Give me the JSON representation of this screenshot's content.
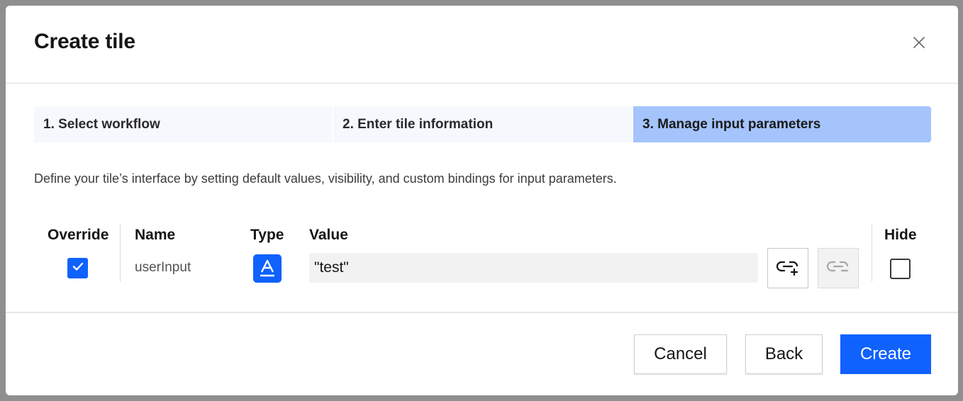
{
  "modal": {
    "title": "Create tile"
  },
  "steps": [
    {
      "label": "1. Select workflow",
      "active": false
    },
    {
      "label": "2. Enter tile information",
      "active": false
    },
    {
      "label": "3. Manage input parameters",
      "active": true
    }
  ],
  "description": "Define your tile’s interface by setting default values, visibility, and custom bindings for input parameters.",
  "table": {
    "headers": {
      "override": "Override",
      "name": "Name",
      "type": "Type",
      "value": "Value",
      "hide": "Hide"
    },
    "rows": [
      {
        "override": true,
        "name": "userInput",
        "type_icon": "text-type-icon",
        "value": "\"test\"",
        "hide": false
      }
    ]
  },
  "icons": {
    "close": "close-icon",
    "bind": "link-add-icon",
    "unbind": "link-remove-icon",
    "check": "checkmark-icon"
  },
  "colors": {
    "accent": "#0f62fe",
    "active_step": "#a4c4fb",
    "step_bg": "#f5f8fc"
  },
  "footer": {
    "cancel_label": "Cancel",
    "back_label": "Back",
    "create_label": "Create"
  }
}
